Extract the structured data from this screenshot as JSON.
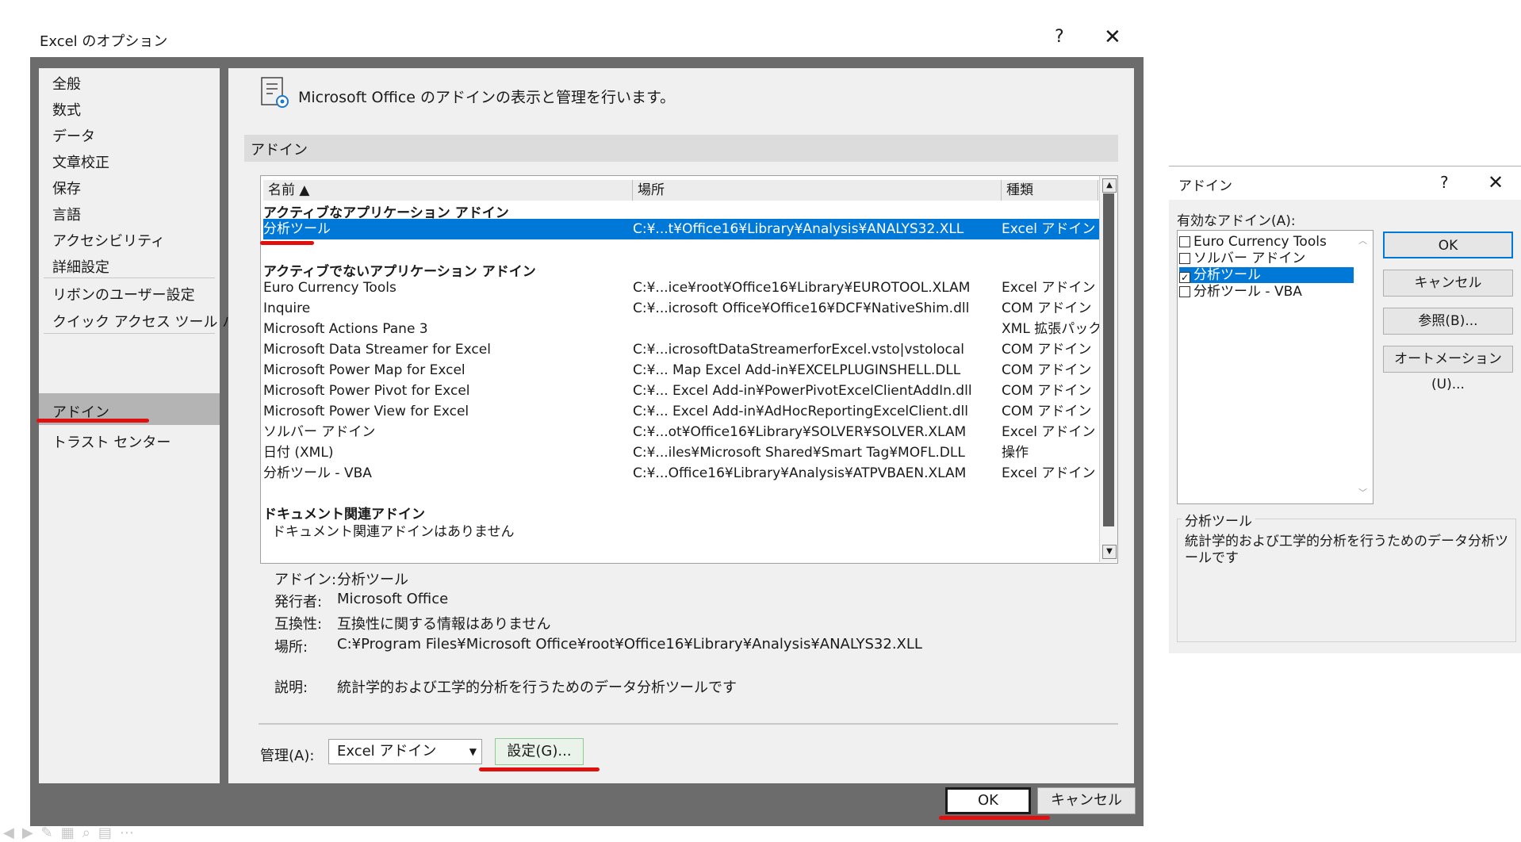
{
  "main_dialog": {
    "title": "Excel のオプション",
    "help": "?",
    "close": "✕",
    "nav": [
      "全般",
      "数式",
      "データ",
      "文章校正",
      "保存",
      "言語",
      "アクセシビリティ",
      "詳細設定",
      "リボンのユーザー設定",
      "クイック アクセス ツール バー",
      "アドイン",
      "トラスト センター"
    ],
    "selected_nav": "アドイン",
    "header": "Microsoft Office のアドインの表示と管理を行います。",
    "section": "アドイン",
    "columns": {
      "name": "名前 ▲",
      "location": "場所",
      "type": "種類"
    },
    "groups": {
      "active": "アクティブなアプリケーション アドイン",
      "inactive": "アクティブでないアプリケーション アドイン",
      "document": "ドキュメント関連アドイン",
      "document_none": "ドキュメント関連アドインはありません"
    },
    "active_rows": [
      {
        "name": "分析ツール",
        "location": "C:¥...t¥Office16¥Library¥Analysis¥ANALYS32.XLL",
        "type": "Excel アドイン"
      }
    ],
    "inactive_rows": [
      {
        "name": "Euro Currency Tools",
        "location": "C:¥...ice¥root¥Office16¥Library¥EUROTOOL.XLAM",
        "type": "Excel アドイン"
      },
      {
        "name": "Inquire",
        "location": "C:¥...icrosoft Office¥Office16¥DCF¥NativeShim.dll",
        "type": "COM アドイン"
      },
      {
        "name": "Microsoft Actions Pane 3",
        "location": "",
        "type": "XML 拡張パック"
      },
      {
        "name": "Microsoft Data Streamer for Excel",
        "location": "C:¥...icrosoftDataStreamerforExcel.vsto|vstolocal",
        "type": "COM アドイン"
      },
      {
        "name": "Microsoft Power Map for Excel",
        "location": "C:¥... Map Excel Add-in¥EXCELPLUGINSHELL.DLL",
        "type": "COM アドイン"
      },
      {
        "name": "Microsoft Power Pivot for Excel",
        "location": "C:¥... Excel Add-in¥PowerPivotExcelClientAddIn.dll",
        "type": "COM アドイン"
      },
      {
        "name": "Microsoft Power View for Excel",
        "location": "C:¥... Excel Add-in¥AdHocReportingExcelClient.dll",
        "type": "COM アドイン"
      },
      {
        "name": "ソルバー アドイン",
        "location": "C:¥...ot¥Office16¥Library¥SOLVER¥SOLVER.XLAM",
        "type": "Excel アドイン"
      },
      {
        "name": "日付 (XML)",
        "location": "C:¥...iles¥Microsoft Shared¥Smart Tag¥MOFL.DLL",
        "type": "操作"
      },
      {
        "name": "分析ツール - VBA",
        "location": "C:¥...Office16¥Library¥Analysis¥ATPVBAEN.XLAM",
        "type": "Excel アドイン"
      }
    ],
    "details": {
      "addin_label": "アドイン:",
      "addin_value": "分析ツール",
      "publisher_label": "発行者:",
      "publisher_value": "Microsoft Office",
      "compat_label": "互換性:",
      "compat_value": "互換性に関する情報はありません",
      "location_label": "場所:",
      "location_value": "C:¥Program Files¥Microsoft Office¥root¥Office16¥Library¥Analysis¥ANALYS32.XLL",
      "desc_label": "説明:",
      "desc_value": "統計学的および工学的分析を行うためのデータ分析ツールです"
    },
    "manage_label": "管理(A):",
    "manage_value": "Excel アドイン",
    "settings_button": "設定(G)...",
    "ok": "OK",
    "cancel": "キャンセル"
  },
  "addin_dialog": {
    "title": "アドイン",
    "help": "?",
    "close": "✕",
    "available_label": "有効なアドイン(A):",
    "items": [
      {
        "label": "Euro Currency Tools",
        "checked": false
      },
      {
        "label": "ソルバー アドイン",
        "checked": false
      },
      {
        "label": "分析ツール",
        "checked": true
      },
      {
        "label": "分析ツール - VBA",
        "checked": false
      }
    ],
    "buttons": {
      "ok": "OK",
      "cancel": "キャンセル",
      "browse": "参照(B)...",
      "automation": "オートメーション(U)..."
    },
    "desc_title": "分析ツール",
    "desc_text": "統計学的および工学的分析を行うためのデータ分析ツールです"
  },
  "colors": {
    "selection": "#0078d7",
    "annotation": "#e01010",
    "frame": "#6c6c6c"
  }
}
